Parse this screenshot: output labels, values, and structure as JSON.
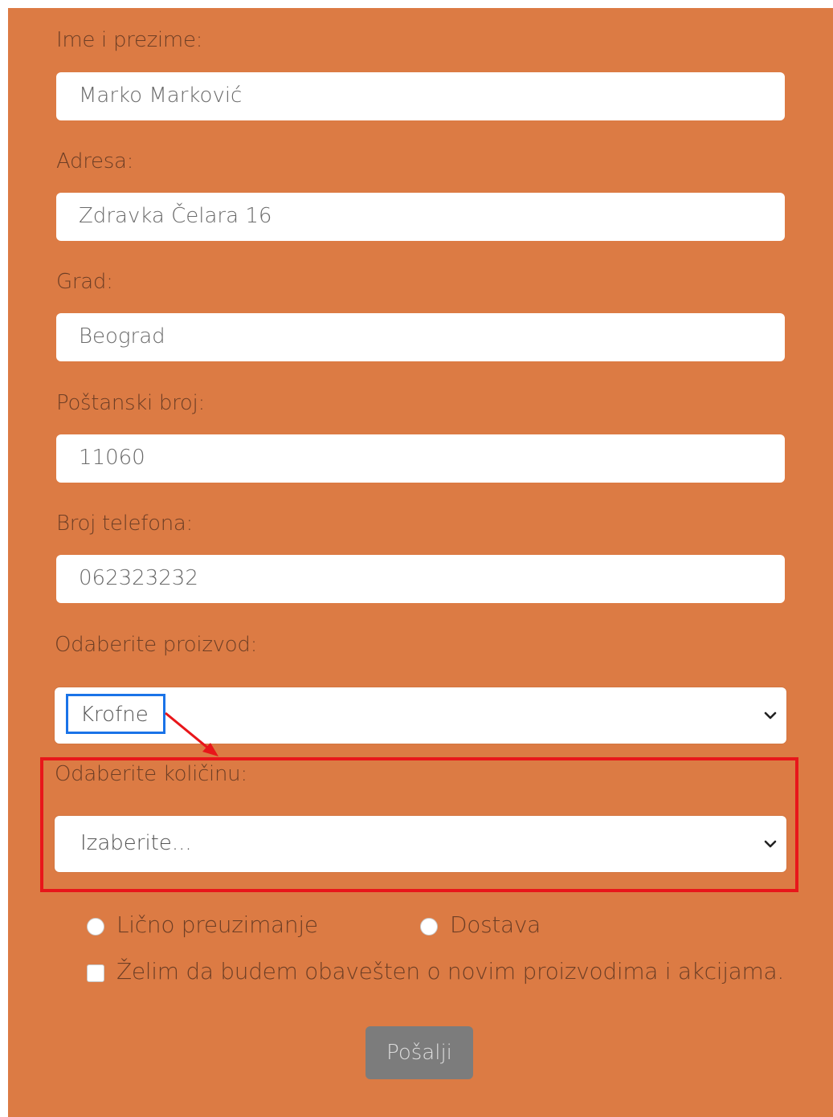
{
  "form": {
    "fields": [
      {
        "label": "Ime i prezime:",
        "value": "Marko Marković"
      },
      {
        "label": "Adresa:",
        "value": "Zdravka Čelara 16"
      },
      {
        "label": "Grad:",
        "value": "Beograd"
      },
      {
        "label": "Poštanski broj:",
        "value": "11060"
      },
      {
        "label": "Broj telefona:",
        "value": "062323232"
      }
    ],
    "product": {
      "label": "Odaberite proizvod:",
      "value": "Krofne"
    },
    "quantity": {
      "label": "Odaberite količinu:",
      "value": "Izaberite..."
    },
    "delivery": {
      "pickup_label": "Lično preuzimanje",
      "delivery_label": "Dostava"
    },
    "newsletter_label": "Želim da budem obavešten o novim proizvodima i akcijama.",
    "submit_label": "Pošalji"
  },
  "colors": {
    "background": "#dc7b44",
    "annotation_box_blue": "#1a73e8",
    "annotation_box_red": "#e8161a",
    "submit_button": "#7c7c7c"
  },
  "icons": {
    "select_arrow": "chevron-down-icon",
    "annotation_arrow": "arrow-icon"
  }
}
